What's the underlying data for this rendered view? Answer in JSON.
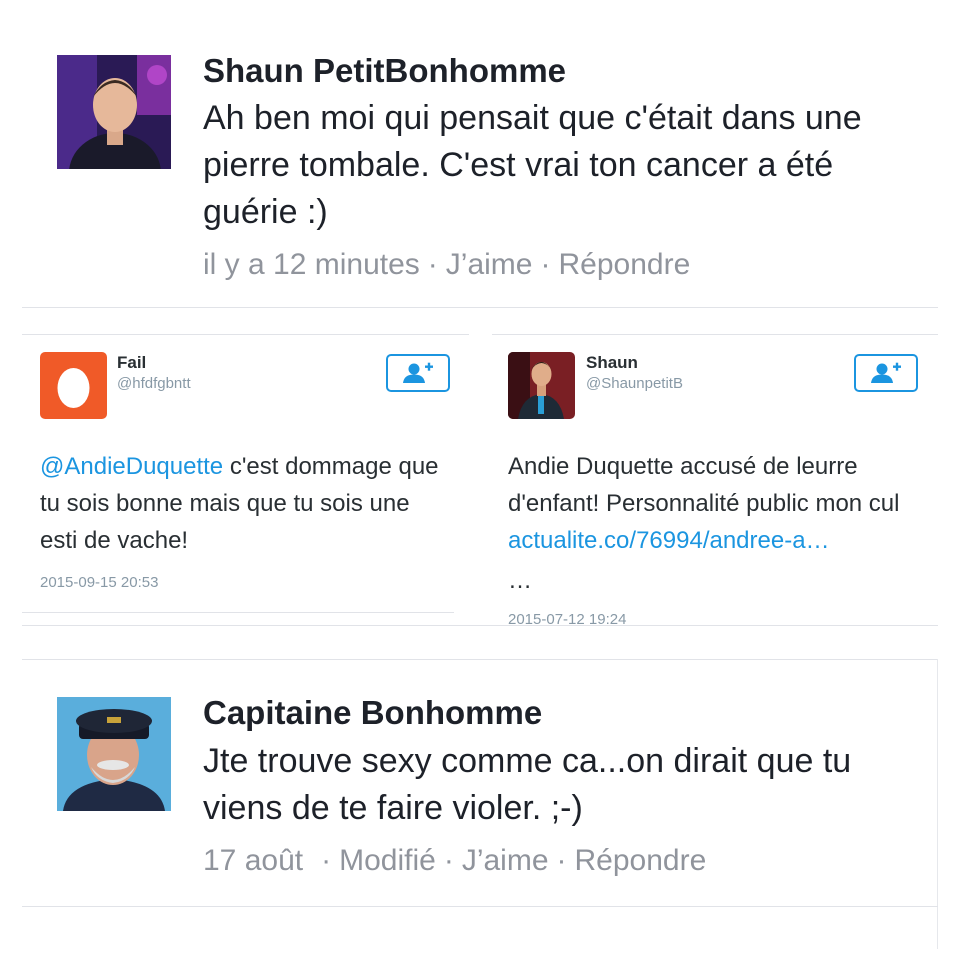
{
  "comment_top": {
    "author": "Shaun PetitBonhomme",
    "text": "Ah ben moi qui pensait que c'était dans une pierre tombale. C'est vrai ton cancer a été guérie :)",
    "time": "il y a 12 minutes",
    "like": "J’aime",
    "reply": "Répondre",
    "separator": "·"
  },
  "tweet_left": {
    "name": "Fail",
    "handle": "@hfdfgbntt",
    "mention": "@AndieDuquette",
    "text": " c'est dommage que tu sois bonne mais que tu sois une esti de vache!",
    "time": "2015-09-15 20:53",
    "avatar_color": "#f05a28"
  },
  "tweet_right": {
    "name": "Shaun",
    "handle": "@ShaunpetitB",
    "text": "Andie Duquette accusé de leurre d'enfant!  Personnalité public mon cul ",
    "link": "actualite.co/76994/andree-a…",
    "ellipsis": "…",
    "time": "2015-07-12 19:24"
  },
  "comment_bottom": {
    "author": "Capitaine Bonhomme",
    "text": "Jte trouve sexy comme ca...on dirait que tu viens de te faire violer. ;-)",
    "time": "17 août",
    "edited": "Modifié",
    "like": "J’aime",
    "reply": "Répondre",
    "separator": "·"
  },
  "colors": {
    "twitter_blue": "#1b95e0",
    "meta_gray": "#90949c"
  }
}
